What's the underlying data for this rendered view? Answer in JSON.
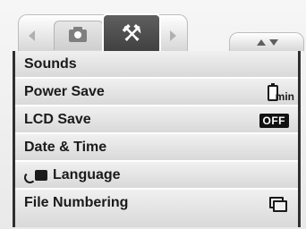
{
  "tabs": [
    {
      "name": "Camera",
      "icon": "camera-icon",
      "selected": false
    },
    {
      "name": "Setup",
      "icon": "wrench-screwdriver-icon",
      "selected": true
    }
  ],
  "menu": {
    "items": [
      {
        "label": "Sounds"
      },
      {
        "label": "Power Save",
        "value_icon": "battery-icon",
        "value_text": "min"
      },
      {
        "label": "LCD Save",
        "value_text": "OFF"
      },
      {
        "label": "Date & Time"
      },
      {
        "label": "Language",
        "icon": "language-camera-icon"
      },
      {
        "label": "File Numbering",
        "value_icon": "file-numbering-icon"
      }
    ]
  }
}
